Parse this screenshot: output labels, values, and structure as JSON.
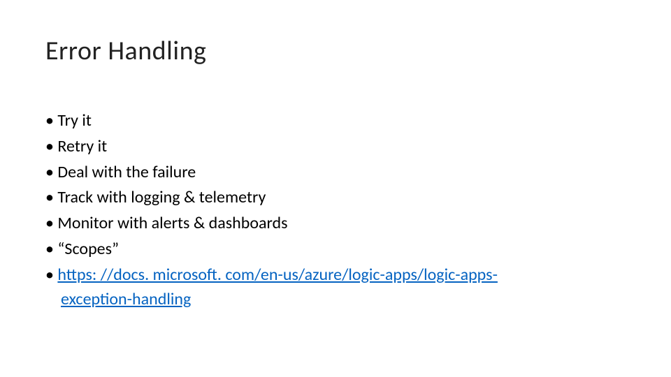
{
  "slide": {
    "title": "Error Handling",
    "bullets": [
      "Try it",
      "Retry it",
      "Deal with the failure",
      "Track with logging & telemetry",
      "Monitor with alerts & dashboards",
      "“Scopes”"
    ],
    "link_line1": "https: //docs. microsoft. com/en-us/azure/logic-apps/logic-apps-",
    "link_line2": "exception-handling"
  }
}
